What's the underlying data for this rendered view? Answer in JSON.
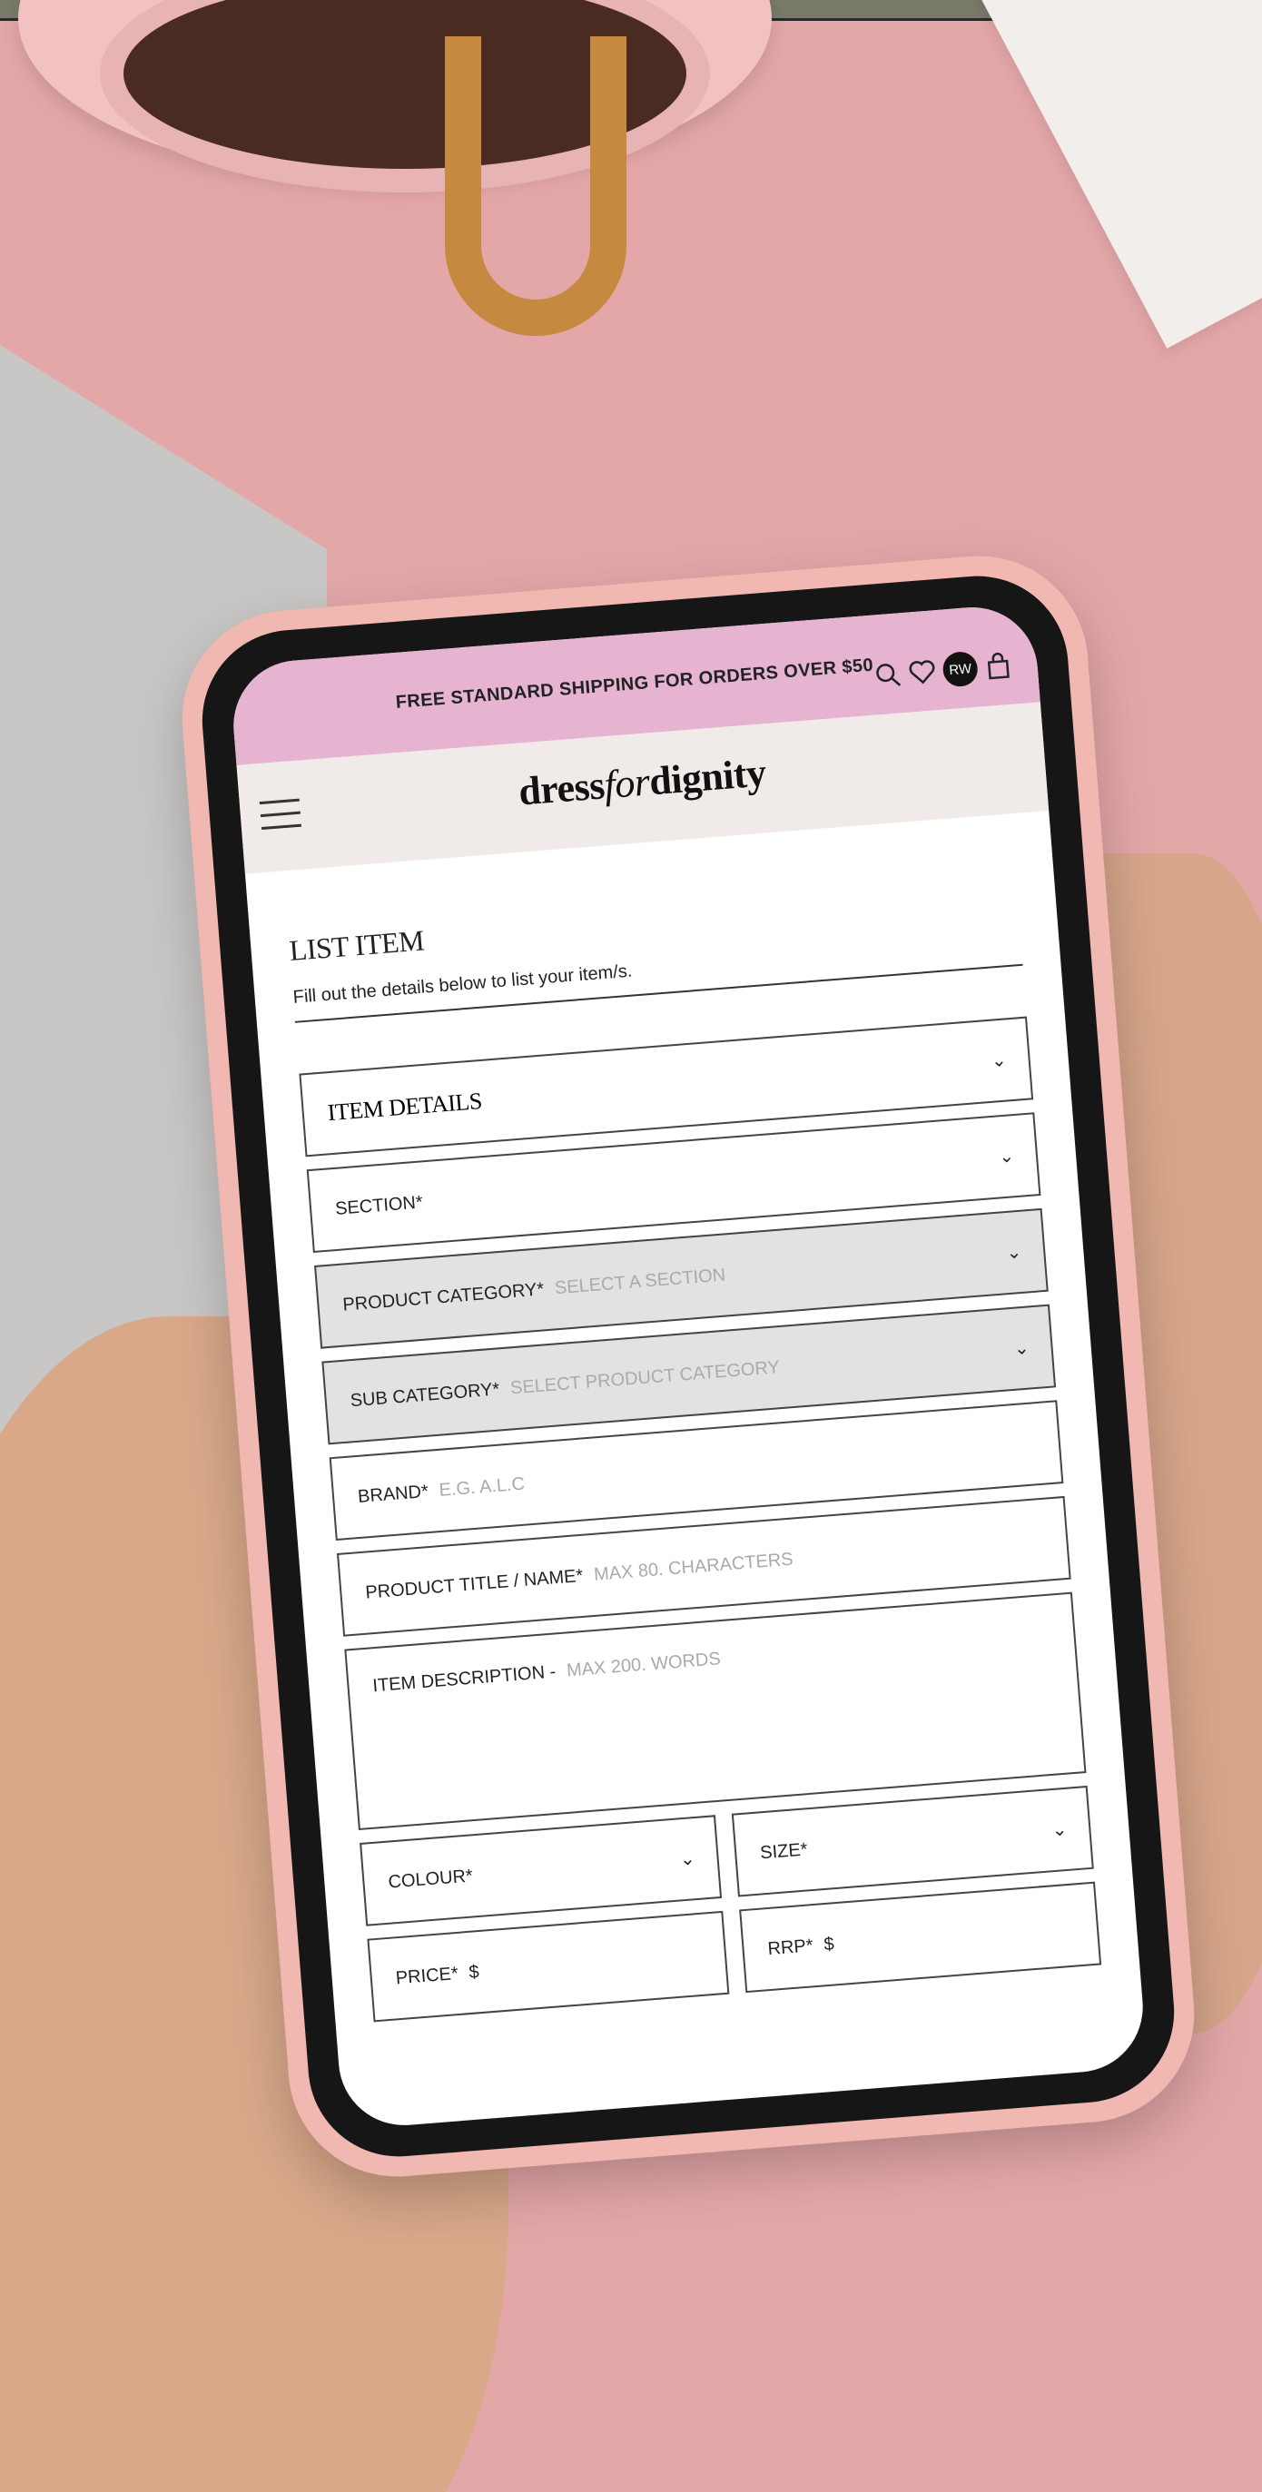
{
  "promo_banner": "FREE STANDARD SHIPPING FOR ORDERS OVER $50",
  "logo": {
    "part1": "dress",
    "part2": "for",
    "part3": "dignity"
  },
  "header_icons": {
    "search": "search-icon",
    "wishlist": "heart-icon",
    "account": "RW",
    "cart": "shopping-bag-icon"
  },
  "page": {
    "title": "LIST ITEM",
    "subtitle": "Fill out the details below to list your item/s."
  },
  "form": {
    "section_title": "ITEM DETAILS",
    "section": {
      "label": "SECTION*"
    },
    "product_category": {
      "label": "PRODUCT CATEGORY*",
      "placeholder": "SELECT A SECTION"
    },
    "sub_category": {
      "label": "SUB CATEGORY*",
      "placeholder": "SELECT PRODUCT CATEGORY"
    },
    "brand": {
      "label": "BRAND*",
      "placeholder": "E.G. A.L.C"
    },
    "product_title": {
      "label": "PRODUCT TITLE / NAME*",
      "placeholder": "MAX 80. CHARACTERS"
    },
    "description": {
      "label": "ITEM DESCRIPTION -",
      "placeholder": "MAX 200. WORDS"
    },
    "colour": {
      "label": "COLOUR*"
    },
    "size": {
      "label": "SIZE*"
    },
    "price": {
      "label": "PRICE*",
      "prefix": "$"
    },
    "rrp": {
      "label": "RRP*",
      "prefix": "$"
    }
  },
  "colors": {
    "promo_bg": "#e6b3d1",
    "header_bg": "#f0ebe8",
    "disabled_field": "#e2e2e5",
    "phone_case": "#f1b7b1"
  }
}
